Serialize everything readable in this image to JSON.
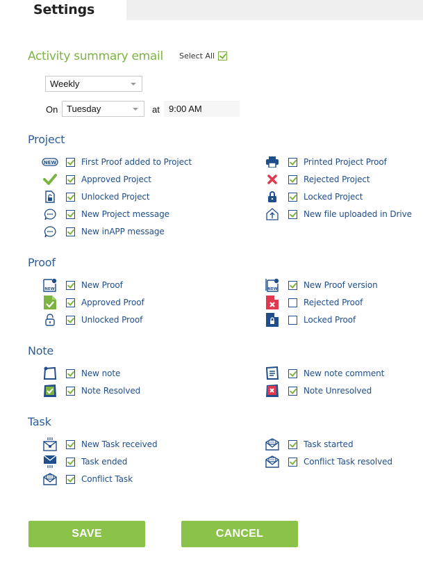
{
  "header": {
    "title": "Settings"
  },
  "activity": {
    "title": "Activity summary email",
    "select_all_label": "Select All",
    "select_all_checked": true,
    "frequency": "Weekly",
    "on_label": "On",
    "day": "Tuesday",
    "at_label": "at",
    "time": "9:00 AM"
  },
  "groups": {
    "project": {
      "title": "Project",
      "items": [
        {
          "label": "First Proof added to Project",
          "icon": "new-badge-icon",
          "checked": true
        },
        {
          "label": "Printed Project Proof",
          "icon": "printer-icon",
          "checked": true
        },
        {
          "label": "Approved Project",
          "icon": "checkmark-icon",
          "checked": true
        },
        {
          "label": "Rejected Project",
          "icon": "x-mark-icon",
          "checked": true
        },
        {
          "label": "Unlocked Project",
          "icon": "unlocked-document-icon",
          "checked": true
        },
        {
          "label": "Locked Project",
          "icon": "lock-icon",
          "checked": true
        },
        {
          "label": "New Project message",
          "icon": "chat-bubble-icon",
          "checked": true
        },
        {
          "label": "New file uploaded in Drive",
          "icon": "upload-icon",
          "checked": true
        },
        {
          "label": "New inAPP message",
          "icon": "chat-bubble-icon",
          "checked": true
        }
      ]
    },
    "proof": {
      "title": "Proof",
      "items": [
        {
          "label": "New Proof",
          "icon": "new-proof-icon",
          "checked": true
        },
        {
          "label": "New Proof version",
          "icon": "new-proof-version-icon",
          "checked": true
        },
        {
          "label": "Approved Proof",
          "icon": "approved-proof-icon",
          "checked": true
        },
        {
          "label": "Rejected Proof",
          "icon": "rejected-proof-icon",
          "checked": false
        },
        {
          "label": "Unlocked Proof",
          "icon": "unlocked-padlock-icon",
          "checked": true
        },
        {
          "label": "Locked Proof",
          "icon": "locked-proof-icon",
          "checked": false
        }
      ]
    },
    "note": {
      "title": "Note",
      "items": [
        {
          "label": "New note",
          "icon": "new-note-icon",
          "checked": true
        },
        {
          "label": "New note comment",
          "icon": "note-comment-icon",
          "checked": true
        },
        {
          "label": "Note Resolved",
          "icon": "note-resolved-icon",
          "checked": true
        },
        {
          "label": "Note Unresolved",
          "icon": "note-unresolved-icon",
          "checked": true
        }
      ]
    },
    "task": {
      "title": "Task",
      "items": [
        {
          "label": "New Task received",
          "icon": "envelope-received-icon",
          "checked": true
        },
        {
          "label": "Task started",
          "icon": "envelope-message-icon",
          "checked": true
        },
        {
          "label": "Task ended",
          "icon": "envelope-filled-icon",
          "checked": true
        },
        {
          "label": "Conflict Task resolved",
          "icon": "envelope-message-icon",
          "checked": true
        },
        {
          "label": "Conflict Task",
          "icon": "envelope-message-icon",
          "checked": true
        }
      ]
    }
  },
  "buttons": {
    "save": "SAVE",
    "cancel": "CANCEL"
  },
  "colors": {
    "accent_green": "#8bc34a",
    "text_blue": "#1f4e8a",
    "reject_red": "#e0384f"
  }
}
